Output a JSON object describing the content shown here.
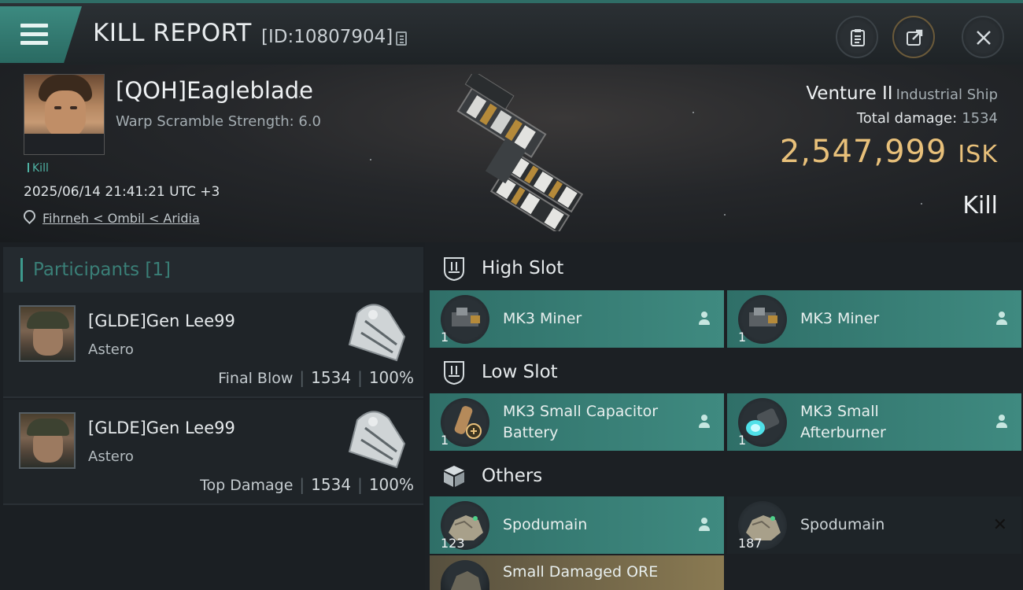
{
  "header": {
    "title": "KILL REPORT",
    "report_id": "[ID:10807904]",
    "buttons": [
      "clipboard-icon",
      "share-icon",
      "close-icon"
    ]
  },
  "victim": {
    "name": "[QOH]Eagleblade",
    "warp_scramble": "Warp Scramble Strength: 6.0",
    "tag": "Kill",
    "timestamp": "2025/06/14 21:41:21 UTC +3",
    "location": "Fihrneh < Ombil < Aridia",
    "ship_name": "Venture II",
    "ship_class": "Industrial Ship",
    "total_damage_label": "Total damage:",
    "total_damage": "1534",
    "isk_value": "2,547,999",
    "isk_unit": "ISK",
    "result": "Kill"
  },
  "participants": {
    "title": "Participants [1]",
    "cards": [
      {
        "name": "[GLDE]Gen Lee99",
        "ship": "Astero",
        "role": "Final Blow",
        "damage": "1534",
        "percent": "100%"
      },
      {
        "name": "[GLDE]Gen Lee99",
        "ship": "Astero",
        "role": "Top Damage",
        "damage": "1534",
        "percent": "100%"
      }
    ]
  },
  "fittings": {
    "high_slot": {
      "label": "High Slot",
      "items": [
        {
          "name": "MK3 Miner",
          "qty": "1"
        },
        {
          "name": "MK3 Miner",
          "qty": "1"
        }
      ]
    },
    "low_slot": {
      "label": "Low Slot",
      "items": [
        {
          "name_line1": "MK3 Small Capacitor",
          "name_line2": "Battery",
          "qty": "1"
        },
        {
          "name_line1": "MK3 Small",
          "name_line2": "Afterburner",
          "qty": "1"
        }
      ]
    },
    "others": {
      "label": "Others",
      "items": [
        {
          "name": "Spodumain",
          "qty": "123"
        },
        {
          "name": "Spodumain",
          "qty": "187"
        },
        {
          "name": "Small Damaged ORE"
        }
      ]
    }
  },
  "colors": {
    "accent_teal": "#3f8a80",
    "isk_gold": "#e8c07a",
    "dropped_item": "#2f6f68",
    "destroyed_item": "#1e2428"
  }
}
